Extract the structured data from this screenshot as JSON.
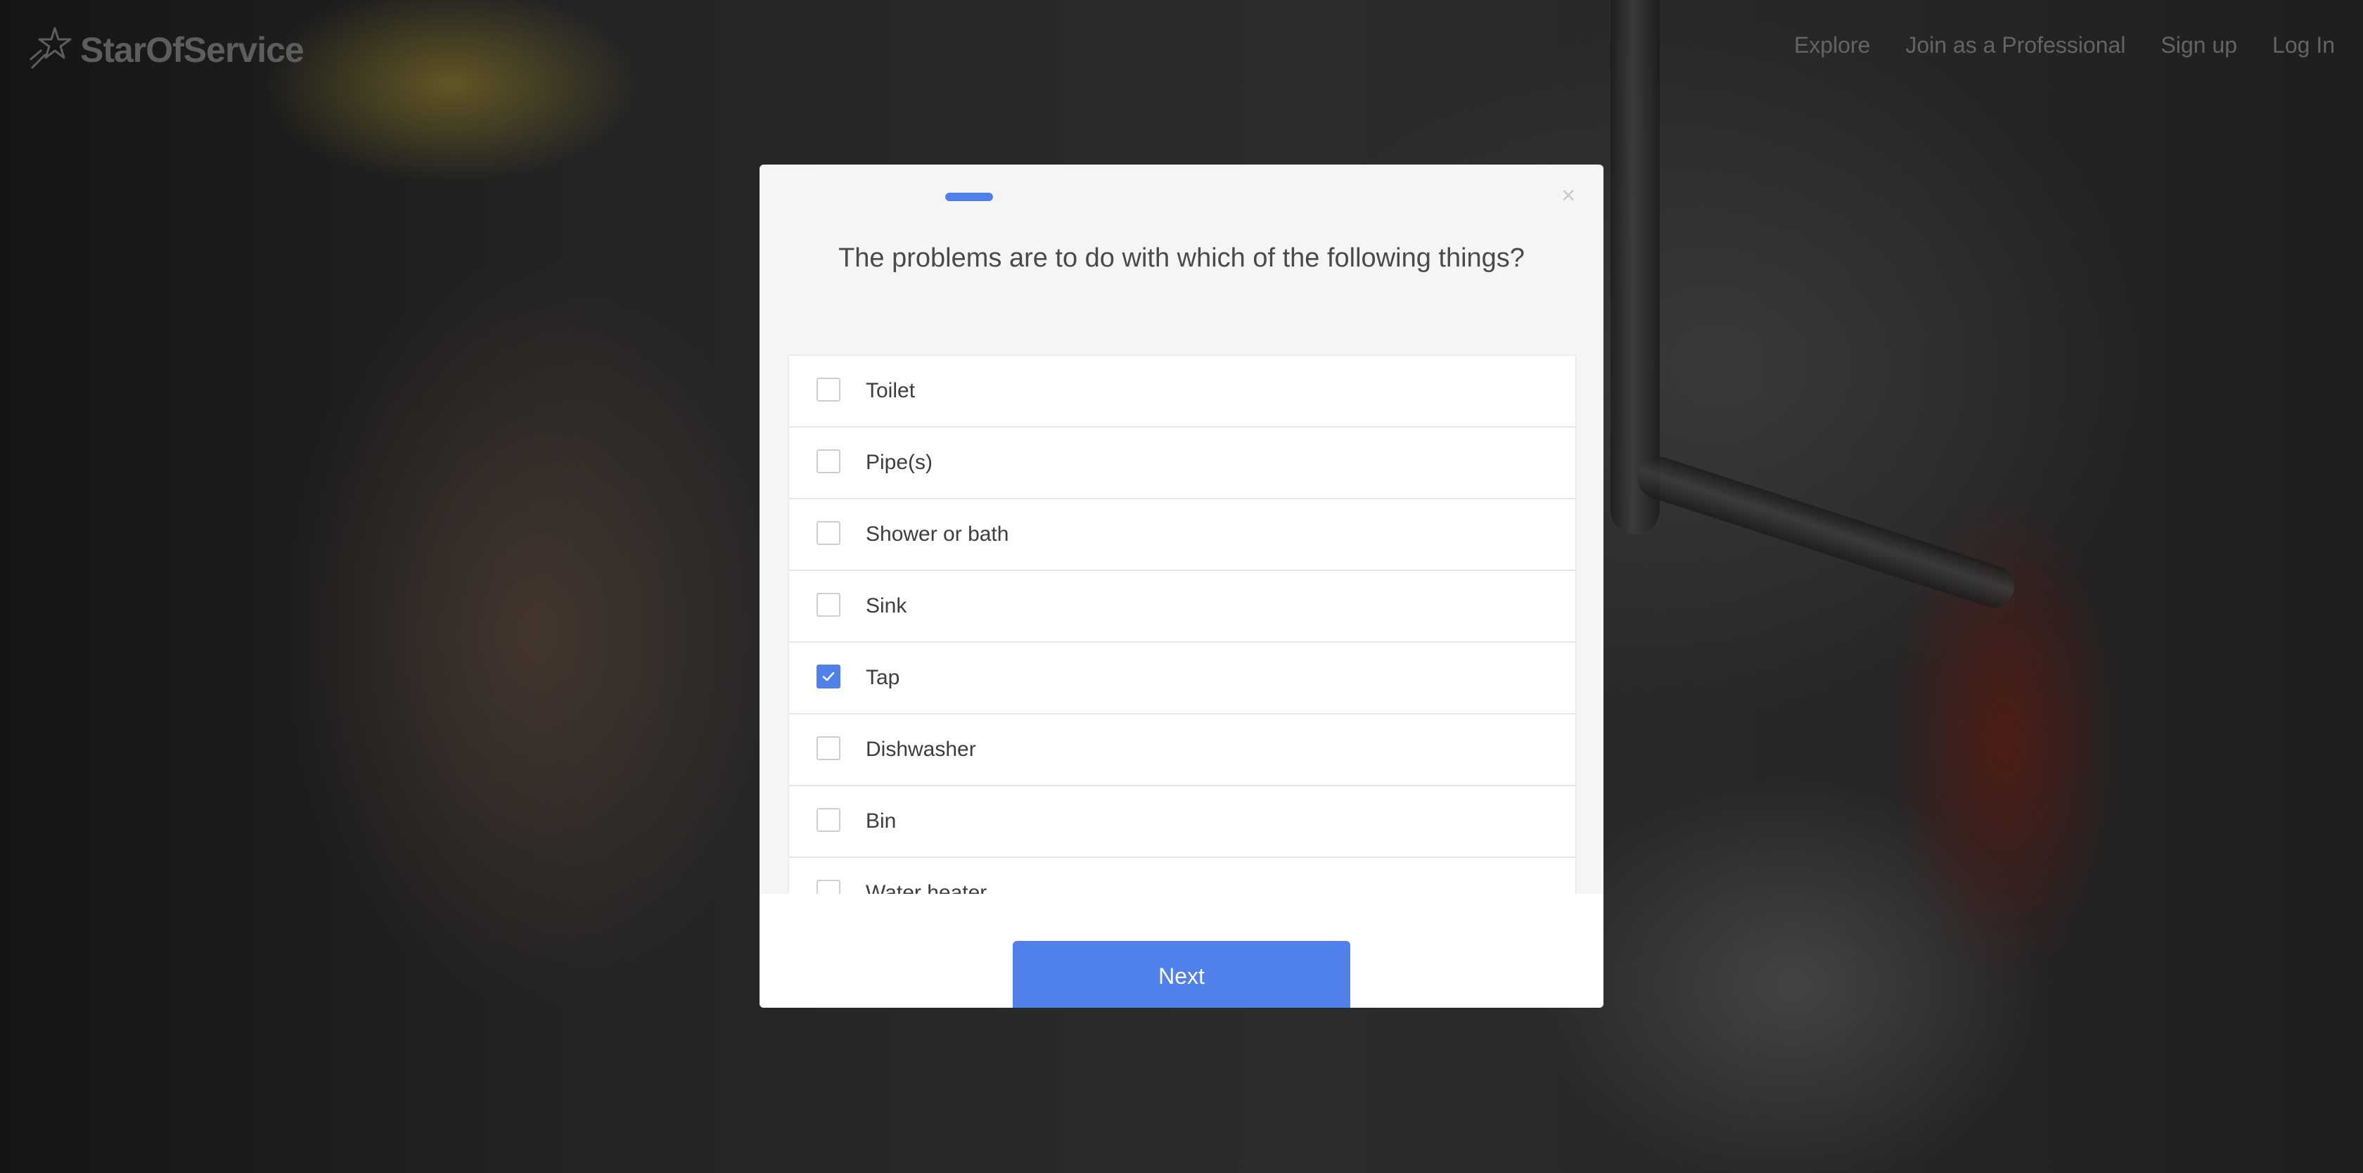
{
  "brand": {
    "name": "StarOfService"
  },
  "nav": {
    "items": [
      {
        "label": "Explore"
      },
      {
        "label": "Join as a Professional"
      },
      {
        "label": "Sign up"
      },
      {
        "label": "Log In"
      }
    ]
  },
  "modal": {
    "close_symbol": "×",
    "question": "The problems are to do with which of the following things?",
    "options": [
      {
        "label": "Toilet",
        "checked": false
      },
      {
        "label": "Pipe(s)",
        "checked": false
      },
      {
        "label": "Shower or bath",
        "checked": false
      },
      {
        "label": "Sink",
        "checked": false
      },
      {
        "label": "Tap",
        "checked": true
      },
      {
        "label": "Dishwasher",
        "checked": false
      },
      {
        "label": "Bin",
        "checked": false
      },
      {
        "label": "Water heater",
        "checked": false
      }
    ],
    "next_label": "Next"
  },
  "colors": {
    "accent": "#5081ea",
    "overlay": "#1b1b1b",
    "modal_bg": "#f5f5f5",
    "text": "#4a4a4a"
  },
  "icons": {
    "logo": "star-logo-icon",
    "close": "close-icon",
    "check": "checkmark-icon"
  }
}
